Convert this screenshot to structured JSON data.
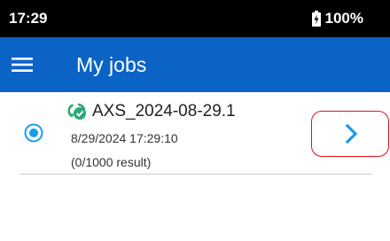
{
  "status_bar": {
    "time": "17:29",
    "battery": "100%"
  },
  "app_bar": {
    "title": "My jobs",
    "menu_icon": "hamburger-menu-icon"
  },
  "jobs": [
    {
      "name": "AXS_2024-08-29.1",
      "date": "8/29/2024 17:29:10",
      "results": "(0/1000 result)",
      "selected": true,
      "status_icon": "sync-check-icon",
      "action_icon": "chevron-right-icon"
    }
  ],
  "colors": {
    "app_bar": "#0b63c5",
    "status_bar": "#000000",
    "accent_blue": "#1a9be8",
    "sync_green": "#2aa876",
    "highlight_red": "#e0101a"
  }
}
